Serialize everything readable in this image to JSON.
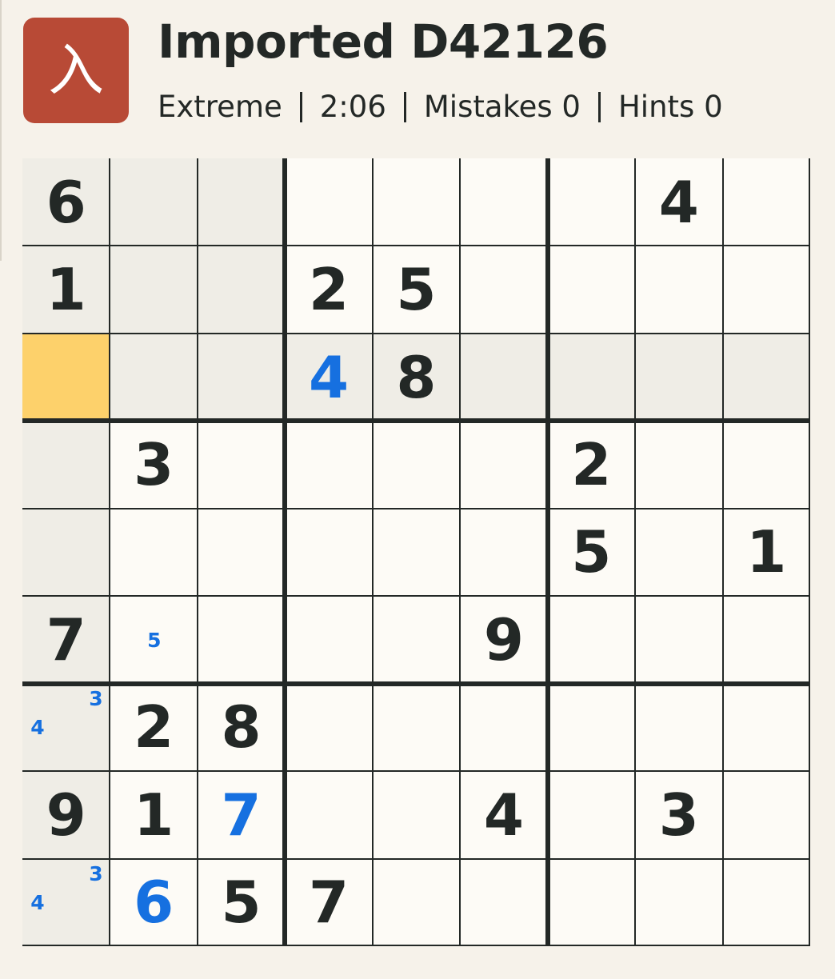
{
  "header": {
    "icon_glyph": "入",
    "icon_name": "app-logo-icon",
    "title": "Imported D42126",
    "difficulty": "Extreme",
    "timer": "2:06",
    "mistakes": "Mistakes 0",
    "hints": "Hints 0"
  },
  "board": {
    "selected": [
      2,
      0
    ],
    "givens": [
      [
        "6",
        "",
        "",
        "",
        "",
        "",
        "",
        "4",
        ""
      ],
      [
        "1",
        "",
        "",
        "2",
        "5",
        "",
        "",
        "",
        ""
      ],
      [
        "",
        "",
        "",
        "",
        "8",
        "",
        "",
        "",
        ""
      ],
      [
        "",
        "3",
        "",
        "",
        "",
        "",
        "2",
        "",
        ""
      ],
      [
        "",
        "",
        "",
        "",
        "",
        "",
        "5",
        "",
        "1"
      ],
      [
        "7",
        "",
        "",
        "",
        "",
        "9",
        "",
        "",
        ""
      ],
      [
        "",
        "2",
        "8",
        "",
        "",
        "",
        "",
        "",
        ""
      ],
      [
        "9",
        "1",
        "",
        "",
        "",
        "4",
        "",
        "3",
        ""
      ],
      [
        "",
        "",
        "5",
        "7",
        "",
        "",
        "",
        "",
        ""
      ]
    ],
    "entries": [
      [
        "",
        "",
        "",
        "",
        "",
        "",
        "",
        "",
        ""
      ],
      [
        "",
        "",
        "",
        "",
        "",
        "",
        "",
        "",
        ""
      ],
      [
        "",
        "",
        "",
        "4",
        "",
        "",
        "",
        "",
        ""
      ],
      [
        "",
        "",
        "",
        "",
        "",
        "",
        "",
        "",
        ""
      ],
      [
        "",
        "",
        "",
        "",
        "",
        "",
        "",
        "",
        ""
      ],
      [
        "",
        "",
        "",
        "",
        "",
        "",
        "",
        "",
        ""
      ],
      [
        "",
        "",
        "",
        "",
        "",
        "",
        "",
        "",
        ""
      ],
      [
        "",
        "",
        "7",
        "",
        "",
        "",
        "",
        "",
        ""
      ],
      [
        "",
        "6",
        "",
        "",
        "",
        "",
        "",
        "",
        ""
      ]
    ],
    "notes": [
      {
        "row": 5,
        "col": 1,
        "digits": [
          "5"
        ]
      },
      {
        "row": 6,
        "col": 0,
        "digits": [
          "3",
          "4"
        ]
      },
      {
        "row": 8,
        "col": 0,
        "digits": [
          "3",
          "4"
        ]
      }
    ]
  }
}
